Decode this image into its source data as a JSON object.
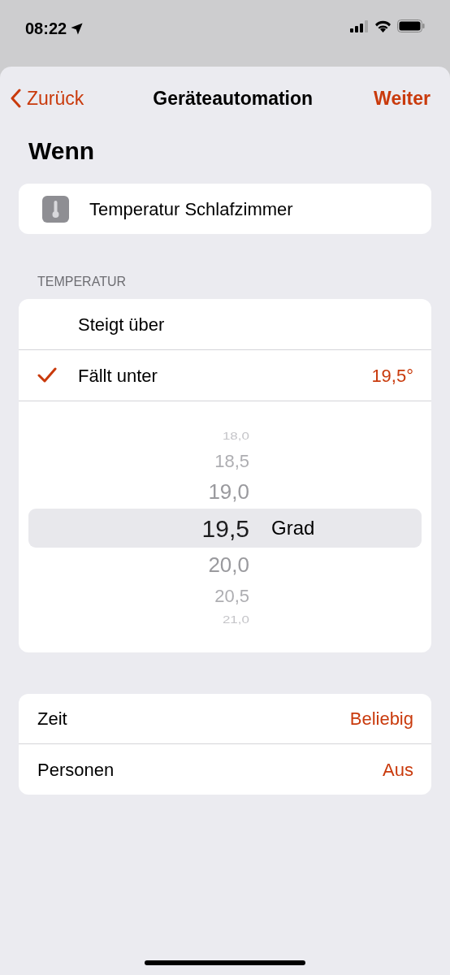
{
  "status_bar": {
    "time": "08:22"
  },
  "nav": {
    "back": "Zurück",
    "title": "Geräteautomation",
    "next": "Weiter"
  },
  "heading": "Wenn",
  "trigger": {
    "name": "Temperatur Schlafzimmer"
  },
  "section_label": "TEMPERATUR",
  "options": [
    {
      "label": "Steigt über",
      "selected": false
    },
    {
      "label": "Fällt unter",
      "selected": true,
      "value": "19,5°"
    }
  ],
  "picker": {
    "unit": "Grad",
    "values": [
      {
        "label": "18,0",
        "selected": false
      },
      {
        "label": "18,5",
        "selected": false
      },
      {
        "label": "19,0",
        "selected": false
      },
      {
        "label": "19,5",
        "selected": true
      },
      {
        "label": "20,0",
        "selected": false
      },
      {
        "label": "20,5",
        "selected": false
      },
      {
        "label": "21,0",
        "selected": false
      }
    ]
  },
  "conditions": [
    {
      "label": "Zeit",
      "value": "Beliebig"
    },
    {
      "label": "Personen",
      "value": "Aus"
    }
  ]
}
